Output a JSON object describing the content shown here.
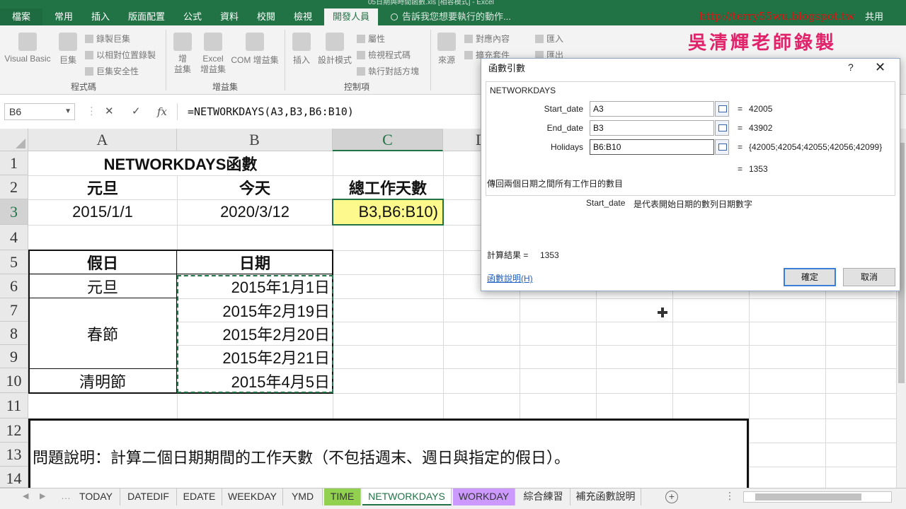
{
  "window": {
    "title": "05日期與時間函數.xls  [相容模式] - Excel"
  },
  "ribbon_tabs": [
    {
      "label": "檔案"
    },
    {
      "label": "常用"
    },
    {
      "label": "插入"
    },
    {
      "label": "版面配置"
    },
    {
      "label": "公式"
    },
    {
      "label": "資料"
    },
    {
      "label": "校閱"
    },
    {
      "label": "檢視"
    },
    {
      "label": "開發人員"
    }
  ],
  "tell_me": "告訴我您想要執行的動作...",
  "share": "共用",
  "watermark": {
    "url": "http://terry55wu.blogspot.tw",
    "author": "吳清輝老師錄製"
  },
  "ribbon": {
    "code": {
      "visual_basic": "Visual Basic",
      "macros": "巨集",
      "record_macro": "錄製巨集",
      "relative_refs": "以相對位置錄製",
      "macro_security": "巨集安全性",
      "group": "程式碼"
    },
    "addins": {
      "addins": "增\n益集",
      "excel_addins": "Excel\n增益集",
      "com_addins": "COM 增益集",
      "group": "增益集"
    },
    "controls": {
      "insert": "插入",
      "design_mode": "設計模式",
      "properties": "屬性",
      "view_code": "檢視程式碼",
      "run_dialog": "執行對話方塊",
      "group": "控制項"
    },
    "xml": {
      "source": "來源",
      "map_properties": "對應內容",
      "expansion_packs": "擴充套件",
      "import": "匯入",
      "export": "匯出"
    }
  },
  "formula_bar": {
    "name_box": "B6",
    "cancel": "✕",
    "enter": "✓",
    "fx": "fx",
    "formula": "=NETWORKDAYS(A3,B3,B6:B10)"
  },
  "columns": [
    "A",
    "B",
    "C",
    "D"
  ],
  "rows": [
    "1",
    "2",
    "3",
    "4",
    "5",
    "6",
    "7",
    "8",
    "9",
    "10",
    "11",
    "12",
    "13",
    "14"
  ],
  "sheet": {
    "title": "NETWORKDAYS函數",
    "h_start": "元旦",
    "h_today": "今天",
    "h_total": "總工作天數",
    "start_date": "2015/1/1",
    "today": "2020/3/12",
    "editing": "B3,B6:B10)",
    "holiday_header": "假日",
    "date_header": "日期",
    "holidays": [
      {
        "name": "元旦",
        "date": "2015年1月1日"
      },
      {
        "name": "春節",
        "date": "2015年2月19日"
      },
      {
        "date": "2015年2月20日"
      },
      {
        "date": "2015年2月21日"
      },
      {
        "name": "清明節",
        "date": "2015年4月5日"
      }
    ],
    "note": "問題說明：計算二個日期期間的工作天數（不包括週末、週日與指定的假日）。"
  },
  "sheet_tabs": [
    {
      "label": "TODAY"
    },
    {
      "label": "DATEDIF"
    },
    {
      "label": "EDATE"
    },
    {
      "label": "WEEKDAY"
    },
    {
      "label": "YMD"
    },
    {
      "label": "TIME"
    },
    {
      "label": "NETWORKDAYS"
    },
    {
      "label": "WORKDAY"
    },
    {
      "label": "綜合練習"
    },
    {
      "label": "補充函數說明"
    }
  ],
  "dialog": {
    "title": "函數引數",
    "help": "?",
    "close": "✕",
    "function_name": "NETWORKDAYS",
    "args": [
      {
        "label": "Start_date",
        "value": "A3",
        "result": "42005"
      },
      {
        "label": "End_date",
        "value": "B3",
        "result": "43902"
      },
      {
        "label": "Holidays",
        "value": "B6:B10",
        "result": "{42005;42054;42055;42056;42099}"
      }
    ],
    "eq": "=",
    "overall_result": "1353",
    "description": "傳回兩個日期之間所有工作日的數目",
    "arg_desc_name": "Start_date",
    "arg_desc": "是代表開始日期的數列日期數字",
    "calc_result": "計算結果 =     1353",
    "help_link": "函數說明(H)",
    "ok": "確定",
    "cancel": "取消"
  },
  "colors": {
    "excel_green": "#217346",
    "active_cell_fill": "#fdf98c",
    "tab_green": "#92d050",
    "tab_purple": "#cc99ff"
  }
}
